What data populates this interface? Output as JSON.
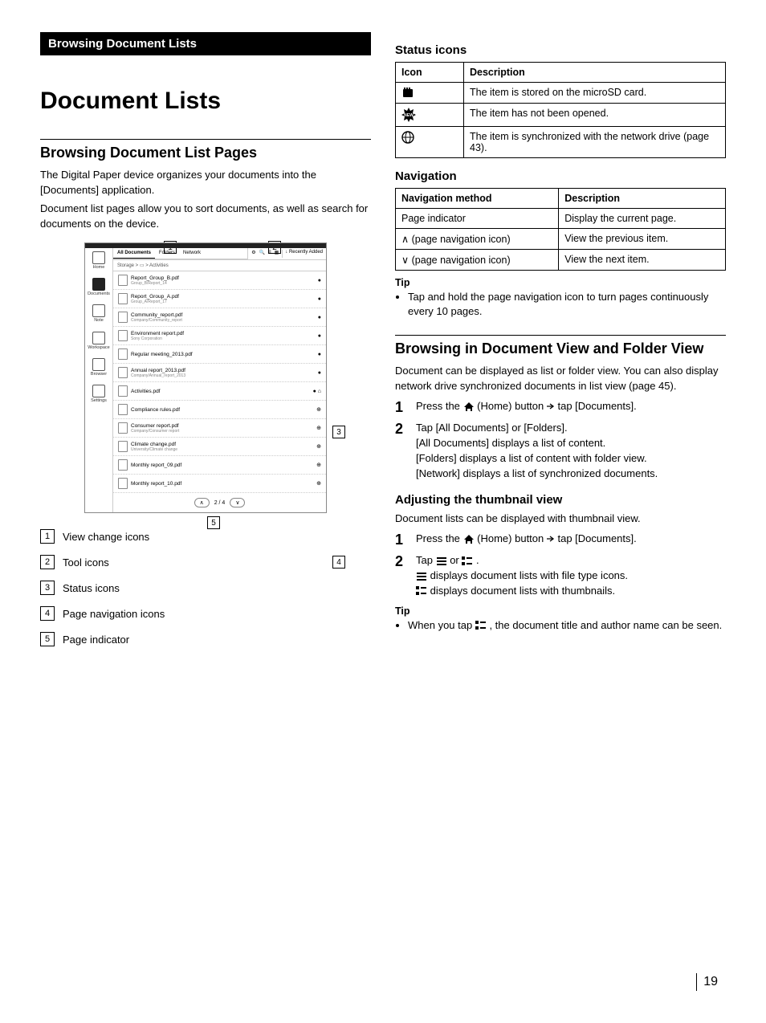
{
  "left": {
    "bar_title": "Browsing Document Lists",
    "h1": "Document Lists",
    "h2": "Browsing Document List Pages",
    "p1": "The Digital Paper device organizes your documents into the [Documents] application.",
    "p2": "Document list pages allow you to sort documents, as well as search for documents on the device.",
    "legend": [
      "View change icons",
      "Tool icons",
      "Status icons",
      "Page navigation icons",
      "Page indicator"
    ]
  },
  "screenshot": {
    "sidebar": [
      "Home",
      "Documents",
      "Note",
      "Workspace",
      "Browser",
      "Settings"
    ],
    "tabs": [
      "All Documents",
      "Folders",
      "Network"
    ],
    "tools_text": "Recently Added",
    "crumb": "Storage  >  ▭  >  Activities",
    "docs": [
      {
        "title": "Report_Group_B.pdf",
        "sub": "Group_B/Report_14",
        "badge": "●"
      },
      {
        "title": "Report_Group_A.pdf",
        "sub": "Group_A/Report_17",
        "badge": "●"
      },
      {
        "title": "Community_report.pdf",
        "sub": "Company/Community_report",
        "badge": "●"
      },
      {
        "title": "Environment report.pdf",
        "sub": "Sony Corporation",
        "badge": "●"
      },
      {
        "title": "Regular meeting_2013.pdf",
        "sub": "",
        "badge": "●"
      },
      {
        "title": "Annual report_2013.pdf",
        "sub": "Company/Annual_report_2013",
        "badge": "●"
      },
      {
        "title": "Activities.pdf",
        "sub": "",
        "badge": "● ⌂"
      },
      {
        "title": "Compliance rules.pdf",
        "sub": "",
        "badge": "⊕"
      },
      {
        "title": "Consumer report.pdf",
        "sub": "Company/Consumer report",
        "badge": "⊕"
      },
      {
        "title": "Climate change.pdf",
        "sub": "University/Climate change",
        "badge": "⊕"
      },
      {
        "title": "Monthly report_09.pdf",
        "sub": "",
        "badge": "⊕"
      },
      {
        "title": "Monthly report_10.pdf",
        "sub": "",
        "badge": "⊕"
      }
    ],
    "pager": "2 / 4"
  },
  "right": {
    "status_h": "Status icons",
    "status_table": {
      "head": [
        "Icon",
        "Description"
      ],
      "rows": [
        {
          "desc": "The item is stored on the microSD card."
        },
        {
          "desc": "The item has not been opened."
        },
        {
          "desc": "The item is synchronized with the network drive (page 43)."
        }
      ]
    },
    "nav_h": "Navigation",
    "nav_table": {
      "head": [
        "Navigation method",
        "Description"
      ],
      "rows": [
        [
          "Page indicator",
          "Display the current page."
        ],
        [
          "∧ (page navigation icon)",
          "View the previous item."
        ],
        [
          "∨ (page navigation icon)",
          "View the next item."
        ]
      ]
    },
    "tip1_label": "Tip",
    "tip1": "Tap and hold the page navigation icon to turn pages continuously every 10 pages.",
    "h2b": "Browsing in Document View and Folder View",
    "p3": "Document can be displayed as list or folder view. You can also display network drive synchronized documents in list view (page 45).",
    "step1_a": "Press the ",
    "step1_b": " (Home) button ",
    "step1_c": " tap [Documents].",
    "step2_a": "Tap [All Documents] or [Folders].",
    "step2_b": "[All Documents] displays a list of content.",
    "step2_c": "[Folders] displays a list of content with folder view.",
    "step2_d": "[Network] displays a list of synchronized documents.",
    "thumb_h": "Adjusting the thumbnail view",
    "thumb_p": "Document lists can be displayed with thumbnail view.",
    "tstep2_a": "Tap ",
    "tstep2_b": " or ",
    "tstep2_c": ".",
    "tline1": " displays document lists with file type icons.",
    "tline2": " displays document lists with thumbnails.",
    "tip2_label": "Tip",
    "tip2_a": "When you tap ",
    "tip2_b": ", the document title and author name can be seen."
  },
  "page_number": "19"
}
